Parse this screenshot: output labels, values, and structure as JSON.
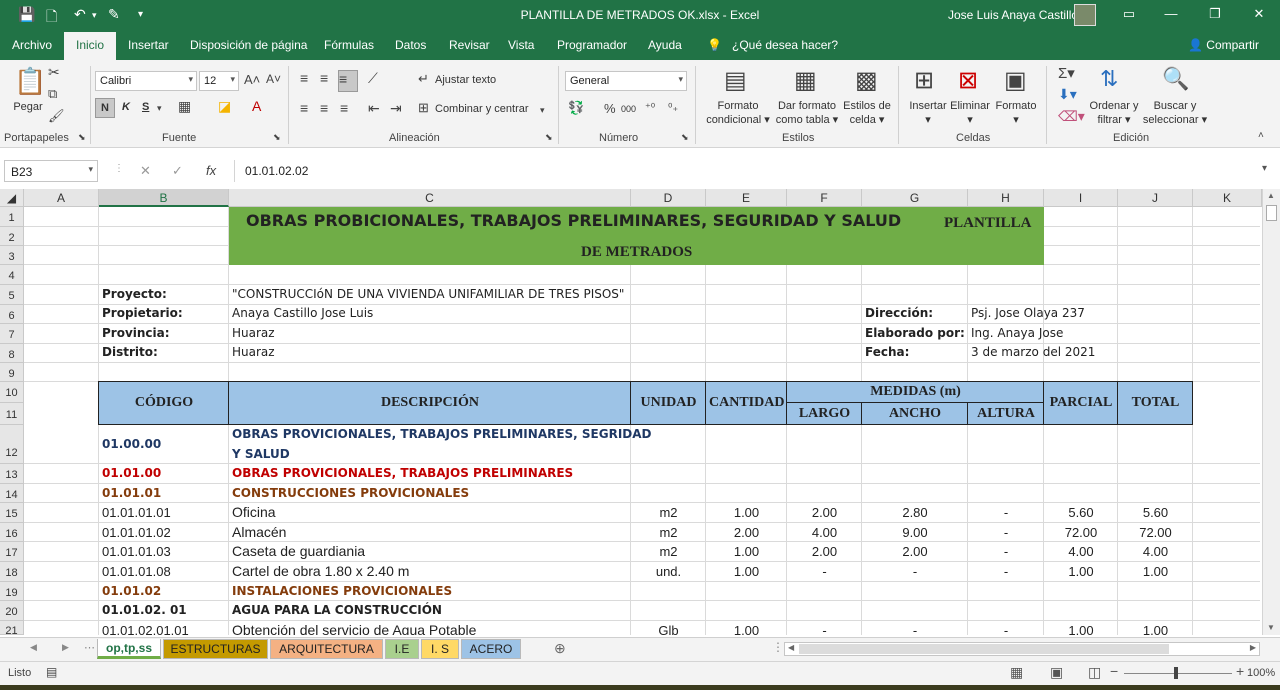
{
  "window": {
    "title": "PLANTILLA  DE METRADOS OK.xlsx  -  Excel",
    "user": "Jose Luis Anaya Castillo"
  },
  "ribbon_tabs": [
    "Archivo",
    "Inicio",
    "Insertar",
    "Disposición de página",
    "Fórmulas",
    "Datos",
    "Revisar",
    "Vista",
    "Programador",
    "Ayuda"
  ],
  "tell_me": "¿Qué desea hacer?",
  "share": "Compartir",
  "ribbon": {
    "paste": "Pegar",
    "font_name": "Calibri",
    "font_size": "12",
    "bold": "N",
    "italic": "K",
    "underline": "S",
    "wrap_text": "Ajustar texto",
    "merge_center": "Combinar y centrar",
    "number_format": "General",
    "cond_format_1": "Formato",
    "cond_format_2": "condicional",
    "format_table_1": "Dar formato",
    "format_table_2": "como tabla",
    "cell_styles_1": "Estilos de",
    "cell_styles_2": "celda",
    "insert": "Insertar",
    "delete": "Eliminar",
    "format": "Formato",
    "sort_1": "Ordenar y",
    "sort_2": "filtrar",
    "find_1": "Buscar y",
    "find_2": "seleccionar",
    "groups": {
      "clipboard": "Portapapeles",
      "font": "Fuente",
      "alignment": "Alineación",
      "number": "Número",
      "styles": "Estilos",
      "cells": "Celdas",
      "editing": "Edición"
    }
  },
  "formula_bar": {
    "cell_ref": "B23",
    "content": "01.01.02.02"
  },
  "columns": [
    "A",
    "B",
    "C",
    "D",
    "E",
    "F",
    "G",
    "H",
    "I",
    "J",
    "K"
  ],
  "rows": [
    "1",
    "2",
    "3",
    "4",
    "5",
    "6",
    "7",
    "8",
    "9",
    "10",
    "11",
    "12",
    "13",
    "14",
    "15",
    "16",
    "17",
    "18",
    "19",
    "20",
    "21"
  ],
  "sheet": {
    "title_1": "OBRAS PROBICIONALES, TRABAJOS PRELIMINARES, SEGURIDAD Y SALUD",
    "title_2": "PLANTILLA",
    "title_3": "DE METRADOS",
    "info": {
      "proyecto_lbl": "Proyecto:",
      "proyecto": "\"CONSTRUCCIóN DE UNA VIVIENDA UNIFAMILIAR DE TRES PISOS\"",
      "propietario_lbl": "Propietario:",
      "propietario": "Anaya Castillo Jose Luis",
      "provincia_lbl": "Provincia:",
      "provincia": "Huaraz",
      "distrito_lbl": "Distrito:",
      "distrito": "Huaraz",
      "direccion_lbl": "Dirección:",
      "direccion": "Psj. Jose Olaya 237",
      "elaborado_lbl": "Elaborado por:",
      "elaborado": "Ing. Anaya Jose",
      "fecha_lbl": "Fecha:",
      "fecha": "3 de marzo del 2021"
    },
    "headers": {
      "codigo": "CÓDIGO",
      "descripcion": "DESCRIPCIÓN",
      "unidad": "UNIDAD",
      "cantidad": "CANTIDAD",
      "medidas": "MEDIDAS (m)",
      "largo": "LARGO",
      "ancho": "ANCHO",
      "altura": "ALTURA",
      "parcial": "PARCIAL",
      "total": "TOTAL"
    },
    "r12_code": "01.00.00",
    "r12_desc_1": "OBRAS PROVICIONALES, TRABAJOS PRELIMINARES, SEGRIDAD",
    "r12_desc_2": "Y SALUD",
    "r13_code": "01.01.00",
    "r13_desc": "OBRAS PROVICIONALES, TRABAJOS PRELIMINARES",
    "r14_code": "01.01.01",
    "r14_desc": "CONSTRUCCIONES PROVICIONALES",
    "items": [
      {
        "code": "01.01.01.01",
        "desc": "Oficina",
        "unit": "m2",
        "qty": "1.00",
        "largo": "2.00",
        "ancho": "2.80",
        "altura": "-",
        "parcial": "5.60",
        "total": "5.60"
      },
      {
        "code": "01.01.01.02",
        "desc": "Almacén",
        "unit": "m2",
        "qty": "2.00",
        "largo": "4.00",
        "ancho": "9.00",
        "altura": "-",
        "parcial": "72.00",
        "total": "72.00"
      },
      {
        "code": "01.01.01.03",
        "desc": "Caseta de guardiania",
        "unit": "m2",
        "qty": "1.00",
        "largo": "2.00",
        "ancho": "2.00",
        "altura": "-",
        "parcial": "4.00",
        "total": "4.00"
      },
      {
        "code": "01.01.01.08",
        "desc": "Cartel de obra  1.80 x 2.40 m",
        "unit": "und.",
        "qty": "1.00",
        "largo": "-",
        "ancho": "-",
        "altura": "-",
        "parcial": "1.00",
        "total": "1.00"
      }
    ],
    "r19_code": "01.01.02",
    "r19_desc": "INSTALACIONES PROVICIONALES",
    "r20_code": "01.01.02. 01",
    "r20_desc": "AGUA PARA LA CONSTRUCCIÓN",
    "r21": {
      "code": "01.01.02.01.01",
      "desc": "Obtención del servicio de Agua Potable",
      "unit": "Glb",
      "qty": "1.00",
      "largo": "-",
      "ancho": "-",
      "altura": "-",
      "parcial": "1.00",
      "total": "1.00"
    }
  },
  "sheet_tabs": [
    "op,tp,ss",
    "ESTRUCTURAS",
    "ARQUITECTURA",
    "I.E",
    "I. S",
    "ACERO"
  ],
  "status": {
    "ready": "Listo",
    "zoom": "100%"
  }
}
